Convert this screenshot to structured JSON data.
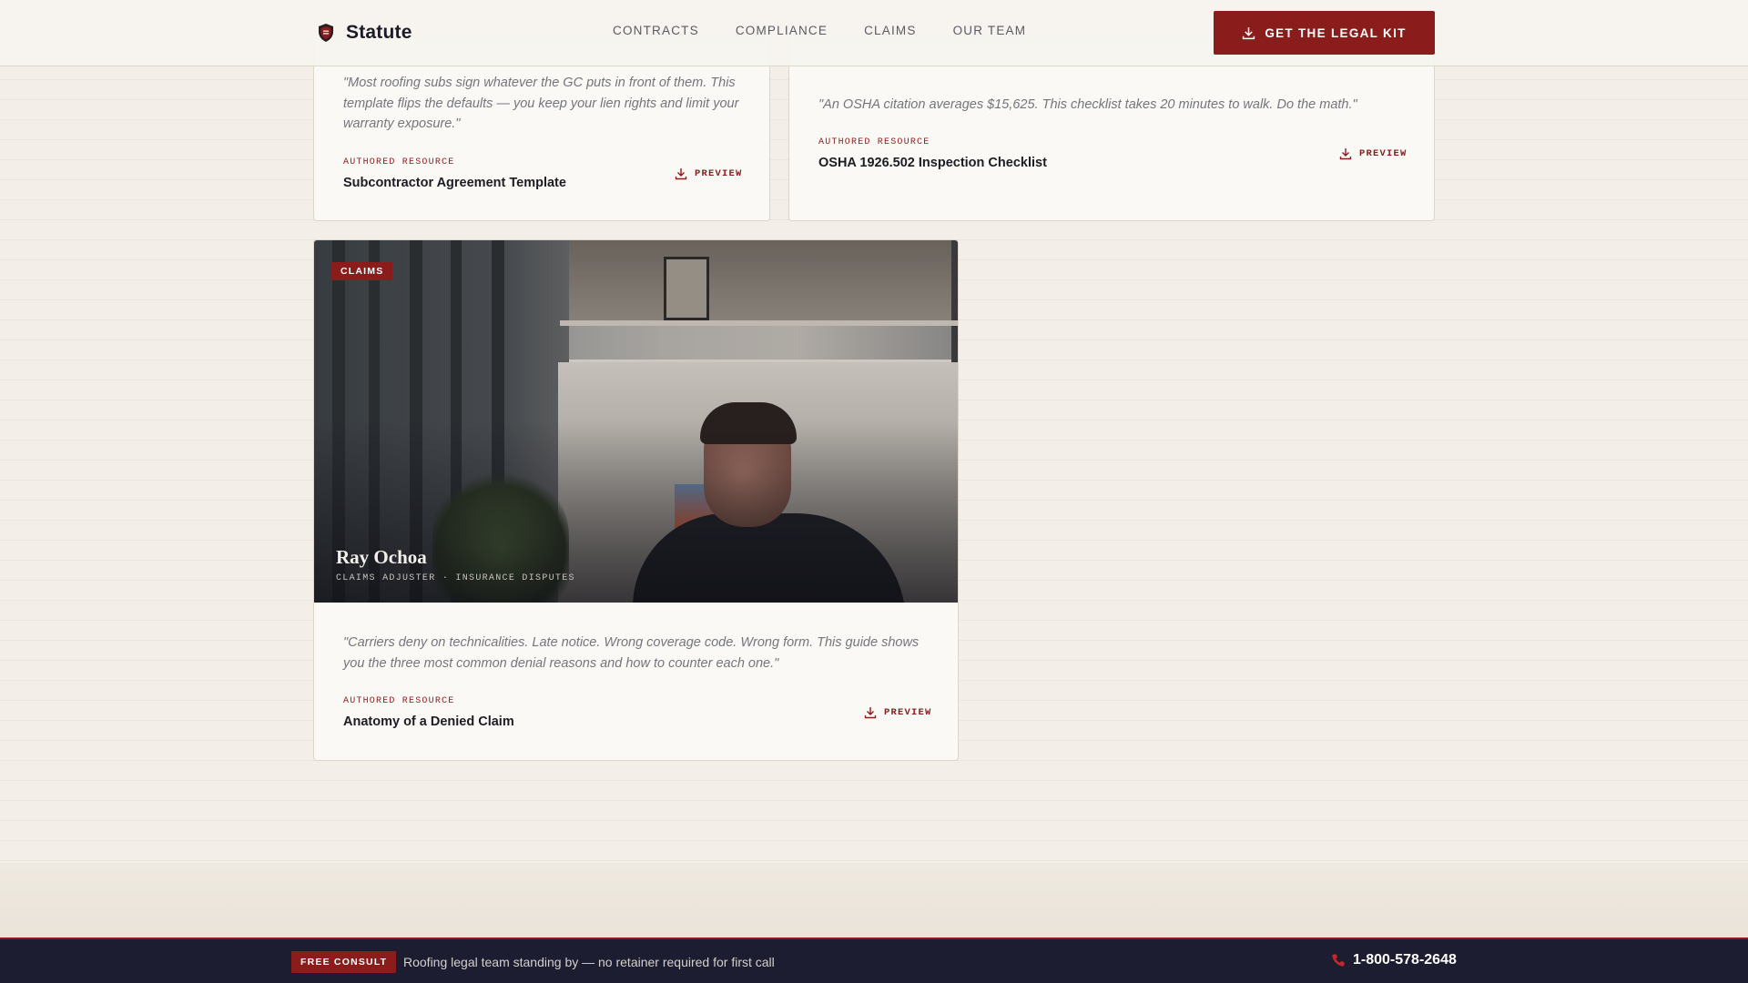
{
  "brand": {
    "name": "Statute"
  },
  "nav": {
    "items": [
      {
        "label": "CONTRACTS"
      },
      {
        "label": "COMPLIANCE"
      },
      {
        "label": "CLAIMS"
      },
      {
        "label": "OUR TEAM"
      }
    ],
    "cta_label": "GET THE LEGAL KIT"
  },
  "cards": [
    {
      "quote": "\"Most roofing subs sign whatever the GC puts in front of them. This template flips the defaults — you keep your lien rights and limit your warranty exposure.\"",
      "label": "AUTHORED RESOURCE",
      "title": "Subcontractor Agreement Template",
      "action": "PREVIEW"
    },
    {
      "quote": "\"An OSHA citation averages $15,625. This checklist takes 20 minutes to walk. Do the math.\"",
      "label": "AUTHORED RESOURCE",
      "title": "OSHA 1926.502 Inspection Checklist",
      "action": "PREVIEW"
    },
    {
      "tag": "CLAIMS",
      "person_name": "Ray Ochoa",
      "person_role": "CLAIMS ADJUSTER · INSURANCE DISPUTES",
      "quote": "\"Carriers deny on technicalities. Late notice. Wrong coverage code. Wrong form. This guide shows you the three most common denial reasons and how to counter each one.\"",
      "label": "AUTHORED RESOURCE",
      "title": "Anatomy of a Denied Claim",
      "action": "PREVIEW"
    }
  ],
  "bottom_bar": {
    "badge": "FREE CONSULT",
    "text": "Roofing legal team standing by — no retainer required for first call",
    "phone": "1-800-578-2648"
  },
  "colors": {
    "accent": "#8a1c1c",
    "bar": "#1c1d30",
    "background": "#f3efe8"
  }
}
